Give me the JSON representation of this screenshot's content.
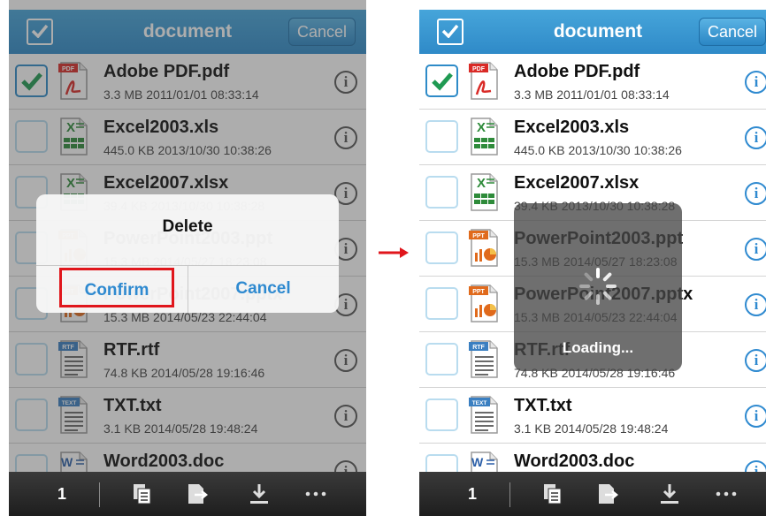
{
  "nav": {
    "title": "document",
    "cancel_label": "Cancel"
  },
  "files": [
    {
      "name": "Adobe PDF.pdf",
      "meta": "3.3 MB 2011/01/01 08:33:14",
      "type": "PDF",
      "checked": true
    },
    {
      "name": "Excel2003.xls",
      "meta": "445.0 KB 2013/10/30 10:38:26",
      "type": "X",
      "checked": false
    },
    {
      "name": "Excel2007.xlsx",
      "meta": "39.4 KB 2013/10/30 10:38:28",
      "type": "X",
      "checked": false
    },
    {
      "name": "PowerPoint2003.ppt",
      "meta": "15.3 MB 2014/05/27 18:23:08",
      "type": "PPT",
      "checked": false
    },
    {
      "name": "PowerPoint2007.pptx",
      "meta": "15.3 MB 2014/05/23 22:44:04",
      "type": "PPT",
      "checked": false
    },
    {
      "name": "RTF.rtf",
      "meta": "74.8 KB 2014/05/28 19:16:46",
      "type": "RTF",
      "checked": false
    },
    {
      "name": "TXT.txt",
      "meta": "3.1 KB 2014/05/28 19:48:24",
      "type": "TEXT",
      "checked": false
    },
    {
      "name": "Word2003.doc",
      "meta": "",
      "type": "W",
      "checked": false
    }
  ],
  "dialog": {
    "title": "Delete",
    "confirm_label": "Confirm",
    "cancel_label": "Cancel"
  },
  "loading": {
    "label": "Loading..."
  },
  "toolbar": {
    "count": "1",
    "icons": [
      "copy-icon",
      "move-icon",
      "download-icon",
      "more-icon"
    ]
  },
  "colors": {
    "accent": "#2f8ad0",
    "highlight": "#e0161c",
    "pdf": "#d92a26",
    "excel": "#2e8b3a",
    "ppt": "#e06a1c",
    "rtf": "#3a7fc1",
    "word": "#2b5fa8"
  }
}
